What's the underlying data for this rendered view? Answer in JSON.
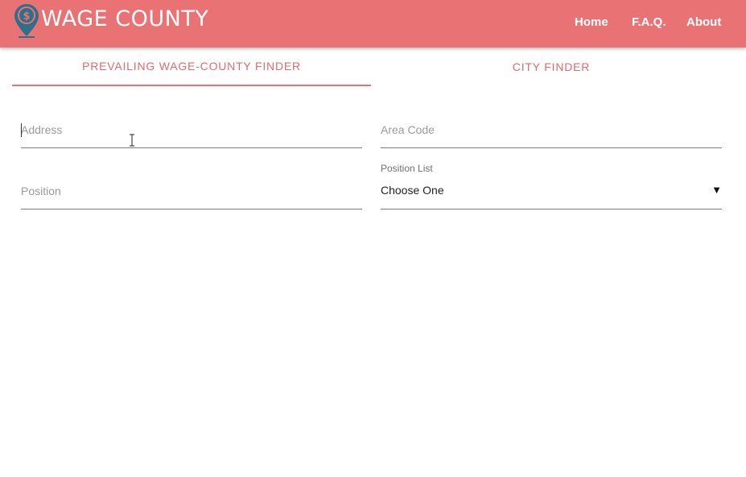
{
  "header": {
    "brand": "WAGE COUNTY",
    "logo_icon": "map-pin-logo-icon",
    "nav": [
      {
        "label": "Home"
      },
      {
        "label": "F.A.Q."
      },
      {
        "label": "About"
      }
    ]
  },
  "tabs": [
    {
      "label": "PREVAILING WAGE-COUNTY FINDER",
      "active": true
    },
    {
      "label": "CITY FINDER",
      "active": false
    }
  ],
  "form": {
    "address": {
      "value": "",
      "placeholder": "Address"
    },
    "area_code": {
      "value": "",
      "placeholder": "Area Code"
    },
    "position": {
      "value": "",
      "placeholder": "Position"
    },
    "position_list": {
      "label": "Position List",
      "selected": "Choose One"
    }
  },
  "colors": {
    "header_bg": "#e97275",
    "accent": "#e06a6d",
    "pin": "#2f6f8a"
  }
}
